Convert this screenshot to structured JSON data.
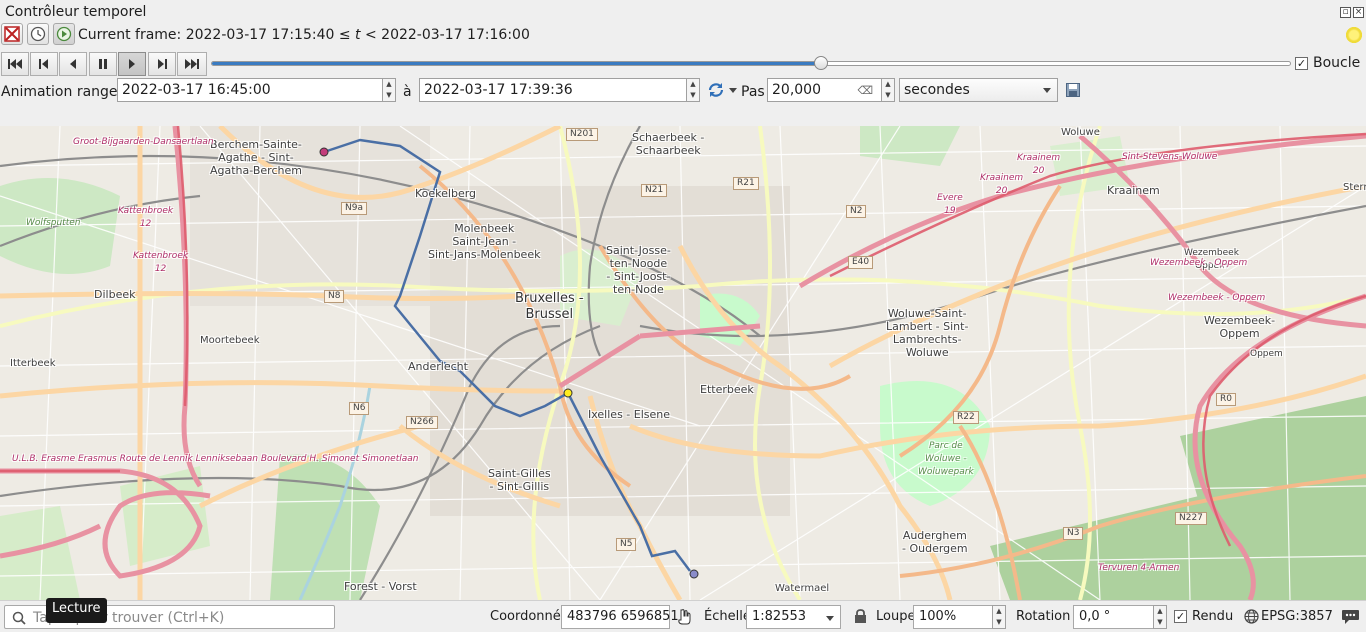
{
  "window": {
    "title": "Contrôleur temporel"
  },
  "frame": {
    "label_prefix": "Current frame: 2022-03-17 17:15:40 ≤ ",
    "label_var": "t",
    "label_suffix": " < 2022-03-17 17:16:00"
  },
  "playback": {
    "progress": 0.565,
    "loop_label": "Boucle",
    "loop_checked": true
  },
  "range": {
    "label": "Animation range",
    "start": "2022-03-17 16:45:00",
    "to_label": "à",
    "end": "2022-03-17 17:39:36",
    "step_label": "Pas",
    "step_value": "20,000",
    "unit": "secondes"
  },
  "map": {
    "labels": {
      "berchem": "Berchem-Sainte-\nAgathe - Sint-\nAgatha-Berchem",
      "koekelberg": "Koekelberg",
      "molenbeek": "Molenbeek\nSaint-Jean -\nSint-Jans-Molenbeek",
      "schaerbeek": "Schaerbeek -\nSchaarbeek",
      "saint_josse": "Saint-Josse-\nten-Noode\n- Sint-Joost-\nten-Node",
      "bruxelles": "Bruxelles -\nBrussel",
      "woluwe_lambert": "Woluwe-Saint-\nLambert - Sint-\nLambrechts-\nWoluwe",
      "kraainem": "Kraainem",
      "wezembeek": "Wezembeek-\nOppem",
      "wezembeek_small": "Wezembeek\nOppem",
      "dilbeek": "Dilbeek",
      "moortebeek": "Moortebeek",
      "itterbeek": "Itterbeek",
      "anderlecht": "Anderlecht",
      "etterbeek": "Etterbeek",
      "ixelles": "Ixelles - Elsene",
      "saint_gilles": "Saint-Gilles\n- Sint-Gillis",
      "auderghem": "Auderghem\n- Oudergem",
      "forest": "Forest - Vorst",
      "watermael": "Watermael",
      "parc": "Parc de\nWoluwe -\nWoluwepark",
      "wolfsputten": "Wolfsputten",
      "groot": "Groot-Bijgaarden-Dansaertlaan",
      "ulb": "U.L.B. Erasme Erasmus Route de Lennik Lenniksebaan Boulevard H. Simonet Simonetlaan",
      "kattenbroek1": "Kattenbroek\n12",
      "kattenbroek2": "Kattenbroek\n12",
      "kraainem_r": "Kraainem\n20",
      "kraainem_r2": "Kraainem\n20",
      "evere": "Evere\n19",
      "stevens": "Sint-Stevens-Woluwe",
      "wez_oppem": "Wezembeek - Oppem",
      "wez_oppem2": "Wezembeek - Oppem",
      "oppem": "Oppem",
      "tervuren": "Tervuren 4-Armen",
      "woluwe": "Woluwe",
      "sterr": "Sterr"
    },
    "shields": [
      "N201",
      "N21",
      "R21",
      "N2",
      "E40",
      "N9a",
      "N8",
      "N6",
      "N266",
      "R22",
      "R0",
      "N227",
      "N3",
      "N5"
    ]
  },
  "status": {
    "locator_placeholder": "Taper pour trouver (Ctrl+K)",
    "tooltip": "Lecture",
    "coord_label": "Coordonnée",
    "coord_value": "483796 6596851",
    "scale_label": "Échelle",
    "scale_value": "1:82553",
    "magnifier_label": "Loupe",
    "magnifier_value": "100%",
    "rotation_label": "Rotation",
    "rotation_value": "0,0 °",
    "render_label": "Rendu",
    "render_checked": true,
    "crs": "EPSG:3857"
  },
  "colors": {
    "accent": "#3a7bc1",
    "route": "#4a6fa5",
    "motorway": "#e892a2",
    "primary": "#fcd6a4",
    "secondary": "#f7fabf",
    "park": "#c8facc",
    "forest": "#add19e",
    "water": "#aad3df"
  }
}
